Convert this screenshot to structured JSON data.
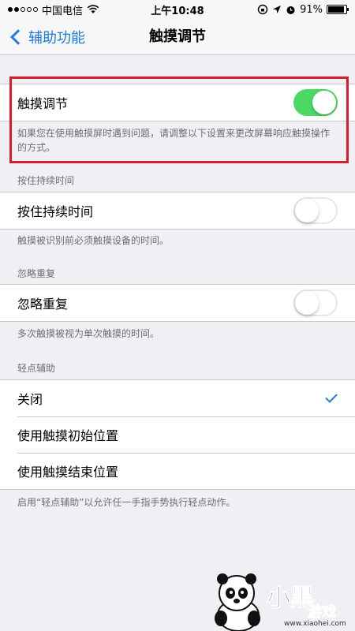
{
  "status_bar": {
    "carrier": "中国电信",
    "time": "上午10:48",
    "battery": "91%"
  },
  "nav": {
    "back_label": "辅助功能",
    "title": "触摸调节"
  },
  "touch_accommodations": {
    "label": "触摸调节",
    "enabled": true,
    "footnote": "如果您在使用触摸屏时遇到问题，请调整以下设置来更改屏幕响应触摸操作的方式。"
  },
  "hold_duration": {
    "header": "按住持续时间",
    "label": "按住持续时间",
    "enabled": false,
    "footnote": "触摸被识别前必须触摸设备的时间。"
  },
  "ignore_repeat": {
    "header": "忽略重复",
    "label": "忽略重复",
    "enabled": false,
    "footnote": "多次触摸被视为单次触摸的时间。"
  },
  "tap_assistance": {
    "header": "轻点辅助",
    "options": [
      {
        "label": "关闭",
        "selected": true
      },
      {
        "label": "使用触摸初始位置",
        "selected": false
      },
      {
        "label": "使用触摸结束位置",
        "selected": false
      }
    ],
    "footnote": "启用“轻点辅助”以允许任一手指手势执行轻点动作。"
  },
  "watermark": {
    "logo_text": "小黑游戏",
    "url": "www.xiaohei.com"
  },
  "colors": {
    "accent": "#1f7ae0",
    "switch_on": "#4cd964",
    "highlight": "#e01a2b",
    "background": "#efeff4"
  }
}
